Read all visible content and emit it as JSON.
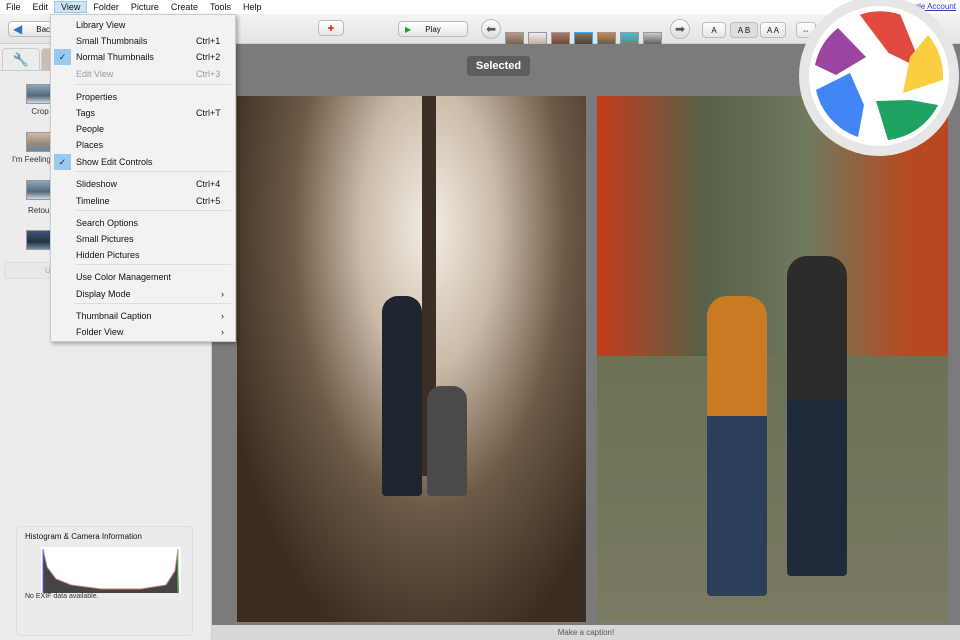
{
  "menubar": {
    "items": [
      "File",
      "Edit",
      "View",
      "Folder",
      "Picture",
      "Create",
      "Tools",
      "Help"
    ],
    "account": "Google Account"
  },
  "toolbar": {
    "back": "Back",
    "play": "Play",
    "layout_a": "A",
    "layout_ab": "A B",
    "layout_aa": "A A"
  },
  "sidebar": {
    "tools": [
      "Crop",
      "I'm Feeling",
      "Retou"
    ],
    "button": "U"
  },
  "histogram": {
    "title": "Histogram & Camera Information",
    "exif": "No EXIF data available."
  },
  "main": {
    "selected": "Selected",
    "caption": "Make a caption!"
  },
  "view_menu": {
    "items": [
      {
        "label": "Library View",
        "shortcut": ""
      },
      {
        "label": "Small Thumbnails",
        "shortcut": "Ctrl+1"
      },
      {
        "label": "Normal Thumbnails",
        "shortcut": "Ctrl+2",
        "checked": true
      },
      {
        "label": "Edit View",
        "shortcut": "Ctrl+3",
        "disabled": true
      },
      {
        "label": "Properties",
        "shortcut": ""
      },
      {
        "label": "Tags",
        "shortcut": "Ctrl+T"
      },
      {
        "label": "People",
        "shortcut": ""
      },
      {
        "label": "Places",
        "shortcut": ""
      },
      {
        "label": "Show Edit Controls",
        "shortcut": "",
        "checked": true
      },
      {
        "label": "Slideshow",
        "shortcut": "Ctrl+4"
      },
      {
        "label": "Timeline",
        "shortcut": "Ctrl+5"
      },
      {
        "label": "Search Options",
        "shortcut": ""
      },
      {
        "label": "Small Pictures",
        "shortcut": ""
      },
      {
        "label": "Hidden Pictures",
        "shortcut": ""
      },
      {
        "label": "Use Color Management",
        "shortcut": ""
      },
      {
        "label": "Display Mode",
        "shortcut": "›"
      },
      {
        "label": "Thumbnail Caption",
        "shortcut": "›"
      },
      {
        "label": "Folder View",
        "shortcut": "›"
      }
    ]
  },
  "colors": {
    "logo_red": "#e04a3f",
    "logo_yellow": "#fbcd41",
    "logo_green": "#1ea362",
    "logo_blue": "#4285f4",
    "logo_purple": "#9c45a0"
  }
}
